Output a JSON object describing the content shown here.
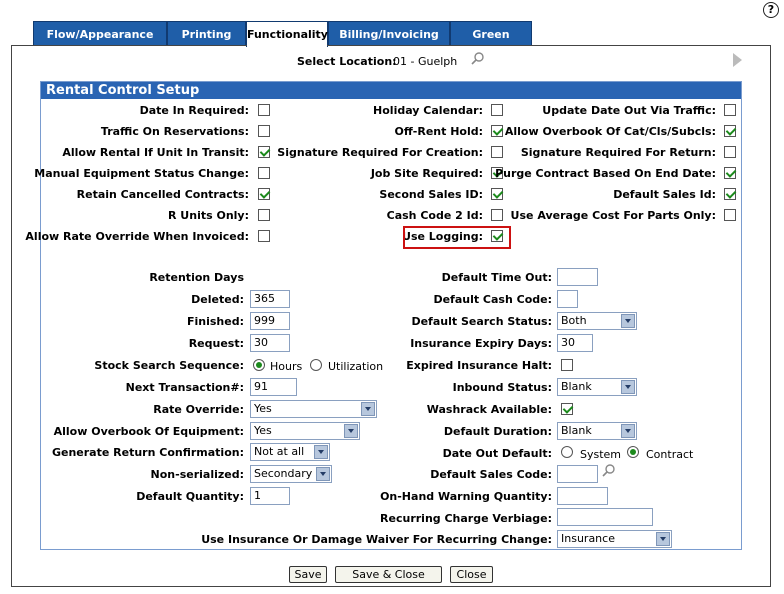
{
  "help": {
    "glyph": "?"
  },
  "tabs": [
    {
      "label": "Flow/Appearance"
    },
    {
      "label": "Printing"
    },
    {
      "label": "Functionality"
    },
    {
      "label": "Billing/Invoicing"
    },
    {
      "label": "Green Screen"
    }
  ],
  "location": {
    "label": "Select Location:",
    "value": "01 - Guelph"
  },
  "section": {
    "title": "Rental Control Setup"
  },
  "checks": [
    {
      "label": "Date In Required:",
      "checked": false
    },
    {
      "label": "Traffic On Reservations:",
      "checked": false
    },
    {
      "label": "Allow Rental If Unit In Transit:",
      "checked": true
    },
    {
      "label": "Manual Equipment Status Change:",
      "checked": false
    },
    {
      "label": "Retain Cancelled Contracts:",
      "checked": true
    },
    {
      "label": "R Units Only:",
      "checked": false
    },
    {
      "label": "Allow Rate Override When Invoiced:",
      "checked": false
    },
    {
      "label": "Holiday Calendar:",
      "checked": false
    },
    {
      "label": "Off-Rent Hold:",
      "checked": true
    },
    {
      "label": "Signature Required For Creation:",
      "checked": false
    },
    {
      "label": "Job Site Required:",
      "checked": true
    },
    {
      "label": "Second Sales ID:",
      "checked": true
    },
    {
      "label": "Cash Code 2 Id:",
      "checked": false
    },
    {
      "label": "Use Logging:",
      "checked": true
    },
    {
      "label": "Update Date Out Via Traffic:",
      "checked": false
    },
    {
      "label": "Allow Overbook Of Cat/Cls/Subcls:",
      "checked": true
    },
    {
      "label": "Signature Required For Return:",
      "checked": false
    },
    {
      "label": "Purge Contract Based On End Date:",
      "checked": true
    },
    {
      "label": "Default Sales Id:",
      "checked": true
    },
    {
      "label": "Use Average Cost For Parts Only:",
      "checked": false
    }
  ],
  "left": {
    "retention_title": "Retention Days",
    "deleted": {
      "label": "Deleted:",
      "value": "365"
    },
    "finished": {
      "label": "Finished:",
      "value": "999"
    },
    "request": {
      "label": "Request:",
      "value": "30"
    },
    "stock_search": {
      "label": "Stock Search Sequence:",
      "opt1": "Hours",
      "opt2": "Utilization"
    },
    "next_trans": {
      "label": "Next Transaction#:",
      "value": "91"
    },
    "rate_override": {
      "label": "Rate Override:",
      "value": "Yes"
    },
    "overbook_equip": {
      "label": "Allow Overbook Of Equipment:",
      "value": "Yes"
    },
    "gen_return": {
      "label": "Generate Return Confirmation:",
      "value": "Not at all"
    },
    "nonserial": {
      "label": "Non-serialized:",
      "value": "Secondary"
    },
    "default_qty": {
      "label": "Default Quantity:",
      "value": "1"
    }
  },
  "right": {
    "default_timeout": {
      "label": "Default Time Out:",
      "value": ""
    },
    "default_cash": {
      "label": "Default Cash Code:",
      "value": ""
    },
    "default_search": {
      "label": "Default Search Status:",
      "value": "Both"
    },
    "ins_expiry": {
      "label": "Insurance Expiry Days:",
      "value": "30"
    },
    "expired_ins": {
      "label": "Expired Insurance Halt:"
    },
    "inbound": {
      "label": "Inbound Status:",
      "value": "Blank"
    },
    "washrack": {
      "label": "Washrack Available:"
    },
    "default_duration": {
      "label": "Default Duration:",
      "value": "Blank"
    },
    "date_out": {
      "label": "Date Out Default:",
      "opt1": "System",
      "opt2": "Contract"
    },
    "default_sales_code": {
      "label": "Default Sales Code:",
      "value": ""
    },
    "onhand": {
      "label": "On-Hand Warning Quantity:",
      "value": ""
    },
    "recurring": {
      "label": "Recurring Charge Verbiage:",
      "value": ""
    },
    "use_ins": {
      "label": "Use Insurance Or Damage Waiver For Recurring Change:",
      "value": "Insurance"
    }
  },
  "buttons": {
    "save": "Save",
    "save_close": "Save & Close",
    "close": "Close"
  }
}
